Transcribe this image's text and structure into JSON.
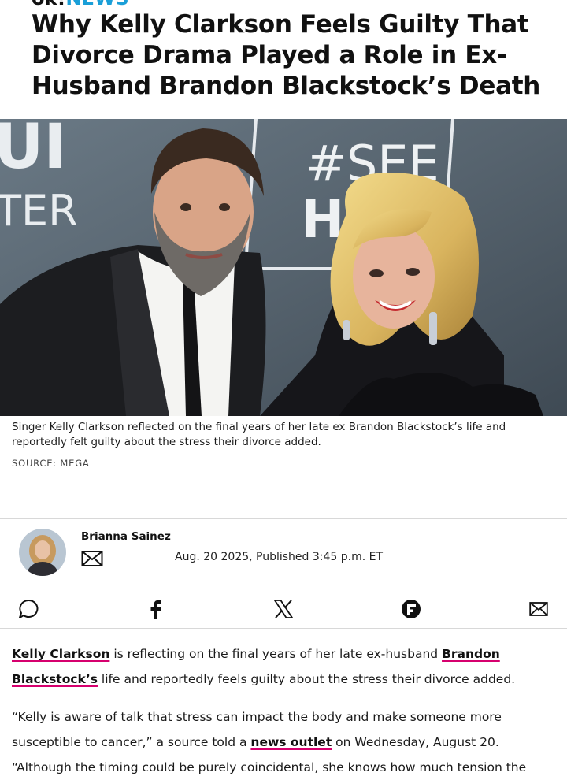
{
  "site": {
    "tag_part1": "ok!",
    "tag_part2": "NEWS"
  },
  "article": {
    "headline": "Why Kelly Clarkson Feels Guilty That Divorce Drama Played a Role in Ex-Husband Brandon Blackstock’s Death",
    "hero_text": {
      "left_top": "UI",
      "left_bottom": "TER",
      "right_top": "#SEE",
      "right_bottom": "HE"
    },
    "caption": "Singer Kelly Clarkson reflected on the final years of her late ex Brandon Blackstock’s life and reportedly felt guilty about the stress their divorce added.",
    "source": "SOURCE: MEGA",
    "author": "Brianna Sainez",
    "published": "Aug. 20 2025, Published 3:45 p.m. ET"
  },
  "share": {
    "icons": [
      "comment-icon",
      "facebook-icon",
      "x-icon",
      "flipboard-icon",
      "email-icon"
    ]
  },
  "body": {
    "p1": {
      "link1": "Kelly Clarkson",
      "text1": " is reflecting on the final years of her late ex-husband ",
      "link2": "Brandon Blackstock’s",
      "text2": " life and reportedly feels guilty about the stress their divorce added."
    },
    "p2": {
      "text1": "“Kelly is aware of talk that stress can impact the body and make someone more susceptible to cancer,” a source told a ",
      "link1": "news outlet",
      "text2": " on Wednesday, August 20. “Although the timing could be purely coincidental, she knows how much tension the"
    }
  },
  "colors": {
    "accent": "#1a9fd8",
    "link_underline": "#d6006e",
    "hero_bg": "#5c6b78"
  }
}
